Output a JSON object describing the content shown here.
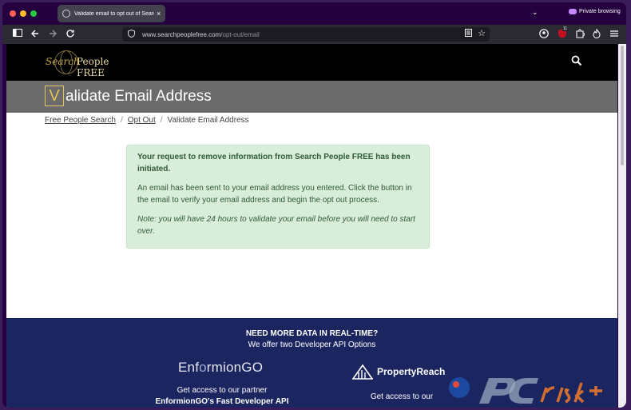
{
  "browser": {
    "tab_title": "Validate email to opt out of Search People FREE",
    "tab_close": "×",
    "tab_list_icon": "⌄",
    "private_label": "Private browsing",
    "url_host": "www.searchpeoplefree.com",
    "url_path": "/opt-out/email",
    "extension_badge": "11"
  },
  "site": {
    "logo_search": "Search",
    "logo_people": "People FREE",
    "hero_letter": "V",
    "hero_rest": "alidate Email Address"
  },
  "breadcrumb": {
    "home": "Free People Search",
    "sep": "/",
    "opt_out": "Opt Out",
    "current": "Validate Email Address"
  },
  "alert": {
    "heading": "Your request to remove information from Search People FREE has been initiated.",
    "body": "An email has been sent to your email address you entered. Click the button in the email to verify your email address and begin the opt out process.",
    "note": "Note: you will have 24 hours to validate your email before you will need to start over."
  },
  "footer": {
    "heading": "NEED MORE DATA IN REAL-TIME?",
    "subheading": "We offer two Developer API Options",
    "partner1_logo_a": "Enf",
    "partner1_logo_o": "o",
    "partner1_logo_b": "rmion",
    "partner1_logo_go": "GO",
    "partner1_text": "Get access to our partner",
    "partner1_strong": "EnformionGO's Fast Developer API",
    "partner2_name": "PropertyReach",
    "partner2_text": "Get access to our"
  },
  "colors": {
    "hero_bg": "#6b6b6b",
    "accent_gold": "#e3c35a",
    "alert_bg": "#d8edda",
    "footer_bg": "#1b2560"
  }
}
